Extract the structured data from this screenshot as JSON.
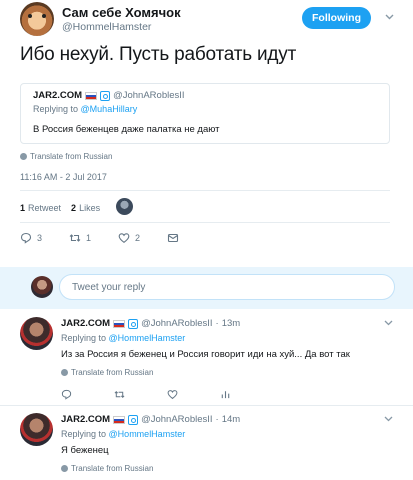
{
  "tweet": {
    "author_name": "Сам себе Хомячок",
    "author_handle": "@HommelHamster",
    "follow_label": "Following",
    "text": "Ибо нехуй. Пусть работать идут",
    "quote": {
      "name": "JAR2.COM",
      "handle": "@JohnARoblesII",
      "replying_prefix": "Replying to",
      "replying_to": "@MuhaHillary",
      "text": "В Россия беженцев даже палатка не дают"
    },
    "translate_label": "Translate from Russian",
    "timestamp": "11:16 AM - 2 Jul 2017",
    "stats": {
      "retweets_count": "1",
      "retweets_label": "Retweet",
      "likes_count": "2",
      "likes_label": "Likes"
    },
    "actions": {
      "replies": "3",
      "retweets": "1",
      "likes": "2"
    }
  },
  "reply_box": {
    "placeholder": "Tweet your reply"
  },
  "replies": [
    {
      "name": "JAR2.COM",
      "handle": "@JohnARoblesII",
      "time": "13m",
      "replying_prefix": "Replying to",
      "replying_to": "@HommelHamster",
      "text": "Из за Россия я беженец и Россия говорит иди на хуй... Да вот так",
      "translate_label": "Translate from Russian"
    },
    {
      "name": "JAR2.COM",
      "handle": "@JohnARoblesII",
      "time": "14m",
      "replying_prefix": "Replying to",
      "replying_to": "@HommelHamster",
      "text": "Я беженец",
      "translate_label": "Translate from Russian"
    }
  ],
  "colors": {
    "accent": "#1da1f2",
    "secondary_text": "#657786",
    "reply_bar_bg": "#e8f5fd"
  }
}
